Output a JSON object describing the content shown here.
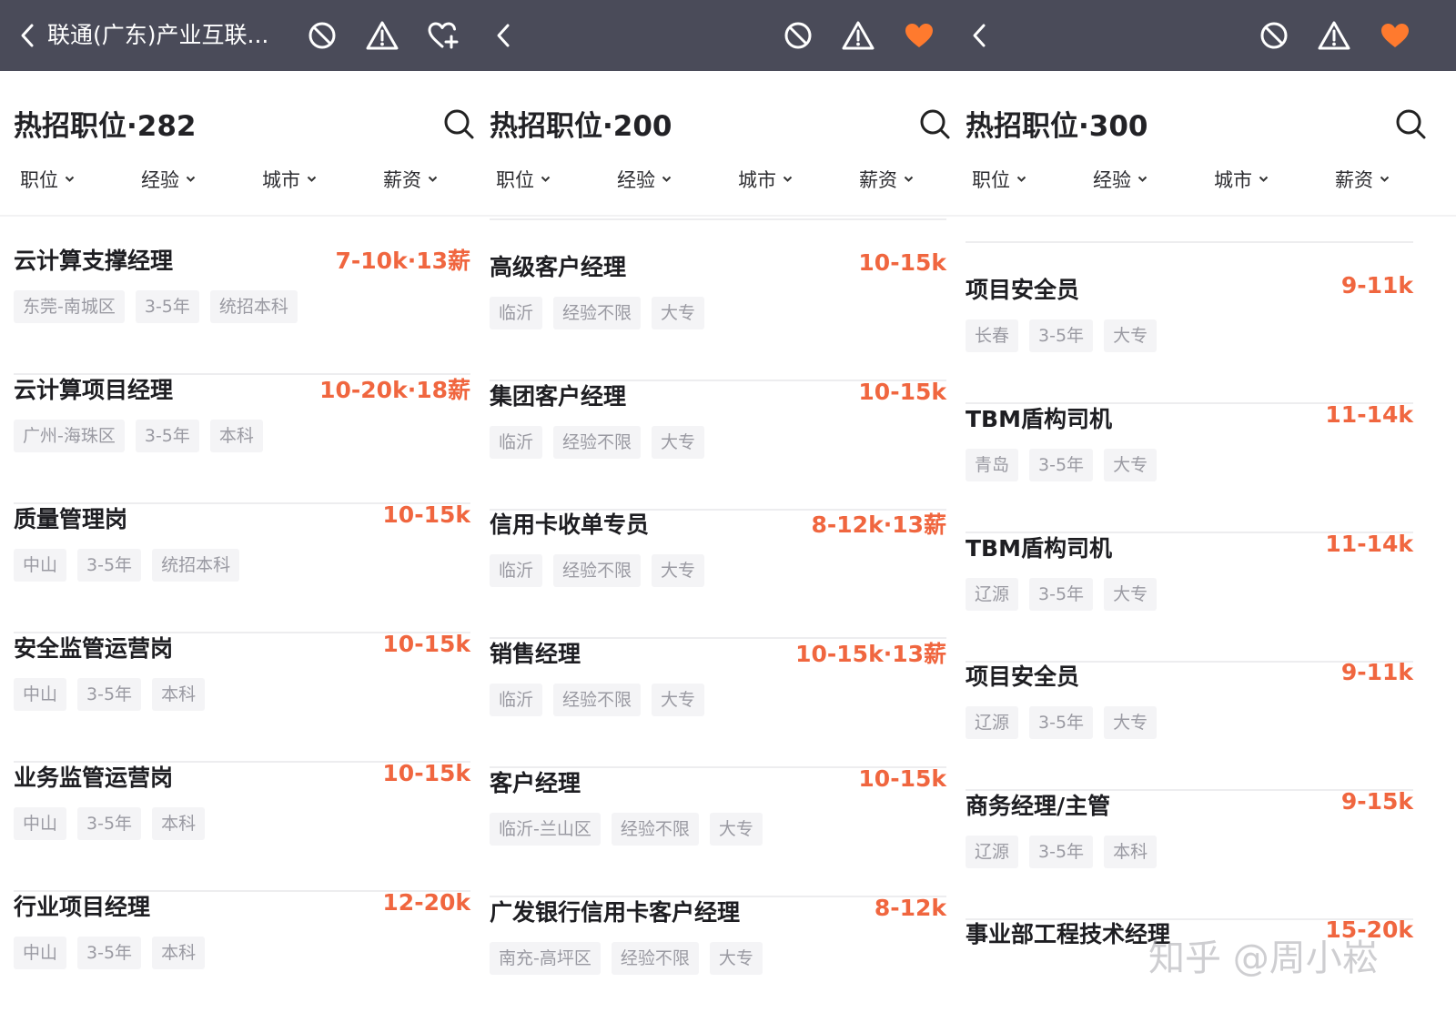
{
  "colors": {
    "topbar": "#4a4b59",
    "salary": "#f0663f",
    "like_active": "#ff7a2e",
    "tag_bg": "#f4f4f6"
  },
  "filters": {
    "position": "职位",
    "experience": "经验",
    "city": "城市",
    "salary": "薪资"
  },
  "panels": [
    {
      "title": "联通(广东)产业互联...",
      "header": "热招职位·282",
      "like_state": "outline-plus",
      "jobs": [
        {
          "title": "云计算支撑经理",
          "salary": "7-10k·13薪",
          "tags": [
            "东莞-南城区",
            "3-5年",
            "统招本科"
          ]
        },
        {
          "title": "云计算项目经理",
          "salary": "10-20k·18薪",
          "tags": [
            "广州-海珠区",
            "3-5年",
            "本科"
          ]
        },
        {
          "title": "质量管理岗",
          "salary": "10-15k",
          "tags": [
            "中山",
            "3-5年",
            "统招本科"
          ]
        },
        {
          "title": "安全监管运营岗",
          "salary": "10-15k",
          "tags": [
            "中山",
            "3-5年",
            "本科"
          ]
        },
        {
          "title": "业务监管运营岗",
          "salary": "10-15k",
          "tags": [
            "中山",
            "3-5年",
            "本科"
          ]
        },
        {
          "title": "行业项目经理",
          "salary": "12-20k",
          "tags": [
            "中山",
            "3-5年",
            "本科"
          ]
        }
      ]
    },
    {
      "title": "",
      "header": "热招职位·200",
      "like_state": "filled",
      "jobs": [
        {
          "title": "高级客户经理",
          "salary": "10-15k",
          "tags": [
            "临沂",
            "经验不限",
            "大专"
          ]
        },
        {
          "title": "集团客户经理",
          "salary": "10-15k",
          "tags": [
            "临沂",
            "经验不限",
            "大专"
          ]
        },
        {
          "title": "信用卡收单专员",
          "salary": "8-12k·13薪",
          "tags": [
            "临沂",
            "经验不限",
            "大专"
          ]
        },
        {
          "title": "销售经理",
          "salary": "10-15k·13薪",
          "tags": [
            "临沂",
            "经验不限",
            "大专"
          ]
        },
        {
          "title": "客户经理",
          "salary": "10-15k",
          "tags": [
            "临沂-兰山区",
            "经验不限",
            "大专"
          ]
        },
        {
          "title": "广发银行信用卡客户经理",
          "salary": "8-12k",
          "tags": [
            "南充-高坪区",
            "经验不限",
            "大专"
          ]
        }
      ]
    },
    {
      "title": "",
      "header": "热招职位·300",
      "like_state": "filled",
      "jobs": [
        {
          "title": "项目安全员",
          "salary": "9-11k",
          "tags": [
            "长春",
            "3-5年",
            "大专"
          ]
        },
        {
          "title": "TBM盾构司机",
          "salary": "11-14k",
          "tags": [
            "青岛",
            "3-5年",
            "大专"
          ]
        },
        {
          "title": "TBM盾构司机",
          "salary": "11-14k",
          "tags": [
            "辽源",
            "3-5年",
            "大专"
          ]
        },
        {
          "title": "项目安全员",
          "salary": "9-11k",
          "tags": [
            "辽源",
            "3-5年",
            "大专"
          ]
        },
        {
          "title": "商务经理/主管",
          "salary": "9-15k",
          "tags": [
            "辽源",
            "3-5年",
            "本科"
          ]
        },
        {
          "title": "事业部工程技术经理",
          "salary": "15-20k",
          "tags": []
        }
      ]
    }
  ],
  "watermark": "知乎 @周小崧"
}
